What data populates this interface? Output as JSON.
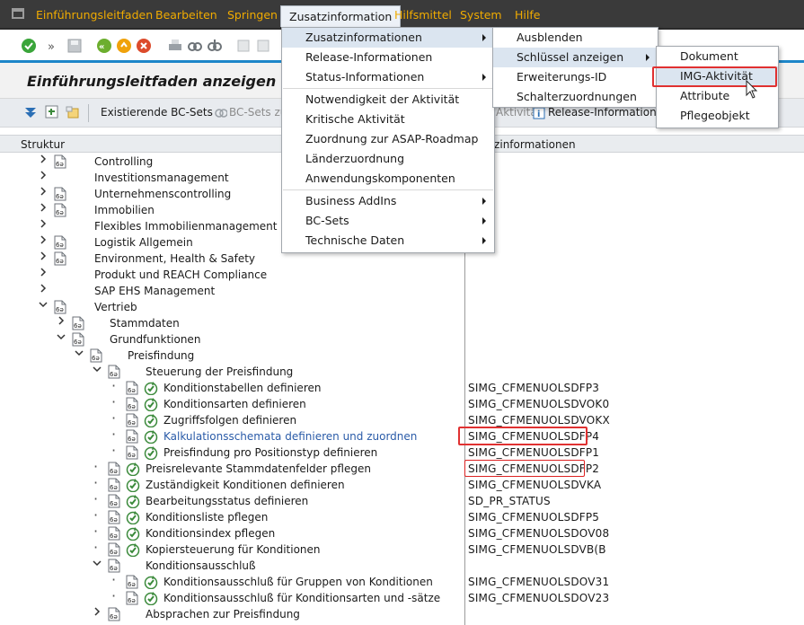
{
  "menubar": {
    "items": [
      "Einführungsleitfaden",
      "Bearbeiten",
      "Springen",
      "Zusatzinformation",
      "Hilfsmittel",
      "System",
      "Hilfe"
    ],
    "active": "Zusatzinformation"
  },
  "title": "Einführungsleitfaden anzeigen",
  "app_toolbar": {
    "existing_bc_sets": "Existierende BC-Sets",
    "bc_sets_partial": "BC-Sets zu",
    "activity_partial": "Aktivität",
    "release_info": "Release-Informationen"
  },
  "tree_header": {
    "structure": "Struktur",
    "info": "Zusatzinformationen",
    "info_partial": "atzinformationen"
  },
  "menu_zusatz": {
    "items": [
      {
        "label": "Zusatzinformationen",
        "submenu": true,
        "highlight": true
      },
      {
        "label": "Release-Informationen",
        "submenu": false
      },
      {
        "label": "Status-Informationen",
        "submenu": true
      },
      {
        "label": "Notwendigkeit der Aktivität",
        "submenu": false
      },
      {
        "label": "Kritische Aktivität",
        "submenu": false
      },
      {
        "label": "Zuordnung zur ASAP-Roadmap",
        "submenu": false
      },
      {
        "label": "Länderzuordnung",
        "submenu": false
      },
      {
        "label": "Anwendungskomponenten",
        "submenu": false
      },
      {
        "label": "Business AddIns",
        "submenu": true
      },
      {
        "label": "BC-Sets",
        "submenu": true
      },
      {
        "label": "Technische Daten",
        "submenu": true
      }
    ]
  },
  "menu_sub1": {
    "items": [
      {
        "label": "Ausblenden",
        "submenu": false
      },
      {
        "label": "Schlüssel anzeigen",
        "submenu": true,
        "highlight": true
      },
      {
        "label": "Erweiterungs-ID",
        "submenu": false
      },
      {
        "label": "Schalterzuordnungen",
        "submenu": false
      }
    ]
  },
  "menu_sub2": {
    "items": [
      {
        "label": "Dokument"
      },
      {
        "label": "IMG-Aktivität",
        "highlight": true
      },
      {
        "label": "Attribute"
      },
      {
        "label": "Pflegeobjekt"
      }
    ]
  },
  "tree": [
    {
      "label": "Controlling",
      "level": 0,
      "exp": ">",
      "icon": "doc",
      "code": ""
    },
    {
      "label": "Investitionsmanagement",
      "level": 0,
      "exp": ">",
      "icon": "none",
      "code": ""
    },
    {
      "label": "Unternehmenscontrolling",
      "level": 0,
      "exp": ">",
      "icon": "doc",
      "code": ""
    },
    {
      "label": "Immobilien",
      "level": 0,
      "exp": ">",
      "icon": "doc",
      "code": ""
    },
    {
      "label": "Flexibles Immobilienmanagement (RE-FX)",
      "level": 0,
      "exp": ">",
      "icon": "none",
      "code": ""
    },
    {
      "label": "Logistik Allgemein",
      "level": 0,
      "exp": ">",
      "icon": "doc",
      "code": ""
    },
    {
      "label": "Environment, Health & Safety",
      "level": 0,
      "exp": ">",
      "icon": "doc",
      "code": ""
    },
    {
      "label": "Produkt und REACH Compliance",
      "level": 0,
      "exp": ">",
      "icon": "none",
      "code": ""
    },
    {
      "label": "SAP EHS Management",
      "level": 0,
      "exp": ">",
      "icon": "none",
      "code": ""
    },
    {
      "label": "Vertrieb",
      "level": 0,
      "exp": "v",
      "icon": "doc",
      "code": ""
    },
    {
      "label": "Stammdaten",
      "level": 1,
      "exp": ">",
      "icon": "doc",
      "code": ""
    },
    {
      "label": "Grundfunktionen",
      "level": 1,
      "exp": "v",
      "icon": "doc",
      "code": ""
    },
    {
      "label": "Preisfindung",
      "level": 2,
      "exp": "v",
      "icon": "doc",
      "code": ""
    },
    {
      "label": "Steuerung der Preisfindung",
      "level": 3,
      "exp": "v",
      "icon": "doc",
      "code": ""
    },
    {
      "label": "Konditionstabellen definieren",
      "level": 4,
      "exp": "•",
      "icon": "act",
      "code": "SIMG_CFMENUOLSDFP3"
    },
    {
      "label": "Konditionsarten definieren",
      "level": 4,
      "exp": "•",
      "icon": "act",
      "code": "SIMG_CFMENUOLSDVOK0"
    },
    {
      "label": "Zugriffsfolgen definieren",
      "level": 4,
      "exp": "•",
      "icon": "act",
      "code": "SIMG_CFMENUOLSDVOKX"
    },
    {
      "label": "Kalkulationsschemata definieren und zuordnen",
      "level": 4,
      "exp": "•",
      "icon": "act",
      "code": "SIMG_CFMENUOLSDFP4",
      "selected": true
    },
    {
      "label": "Preisfindung pro Positionstyp definieren",
      "level": 4,
      "exp": "•",
      "icon": "act",
      "code": "SIMG_CFMENUOLSDFP1"
    },
    {
      "label": "Preisrelevante Stammdatenfelder pflegen",
      "level": 3,
      "exp": "•",
      "icon": "act",
      "code": "SIMG_CFMENUOLSDFP2"
    },
    {
      "label": "Zuständigkeit Konditionen definieren",
      "level": 3,
      "exp": "•",
      "icon": "act",
      "code": "SIMG_CFMENUOLSDVKA"
    },
    {
      "label": "Bearbeitungsstatus definieren",
      "level": 3,
      "exp": "•",
      "icon": "act",
      "code": "SD_PR_STATUS"
    },
    {
      "label": "Konditionsliste pflegen",
      "level": 3,
      "exp": "•",
      "icon": "act",
      "code": "SIMG_CFMENUOLSDFP5"
    },
    {
      "label": "Konditionsindex pflegen",
      "level": 3,
      "exp": "•",
      "icon": "act",
      "code": "SIMG_CFMENUOLSDOV08"
    },
    {
      "label": "Kopiersteuerung für Konditionen",
      "level": 3,
      "exp": "•",
      "icon": "act",
      "code": "SIMG_CFMENUOLSDVB(B"
    },
    {
      "label": "Konditionsausschluß",
      "level": 3,
      "exp": "v",
      "icon": "doc",
      "code": ""
    },
    {
      "label": "Konditionsausschluß für Gruppen von Konditionen",
      "level": 4,
      "exp": "•",
      "icon": "act",
      "code": "SIMG_CFMENUOLSDOV31"
    },
    {
      "label": "Konditionsausschluß für Konditionsarten und -sätze",
      "level": 4,
      "exp": "•",
      "icon": "act",
      "code": "SIMG_CFMENUOLSDOV23"
    },
    {
      "label": "Absprachen zur Preisfindung",
      "level": 3,
      "exp": ">",
      "icon": "doc",
      "code": ""
    }
  ],
  "colors": {
    "menubar_bg": "#3a3a3a",
    "menu_text": "#f0ab00",
    "accent_line": "#1d86c9",
    "highlight": "#dbe5f0",
    "red_marker": "#e03131",
    "selected_text": "#2a5ba8"
  }
}
